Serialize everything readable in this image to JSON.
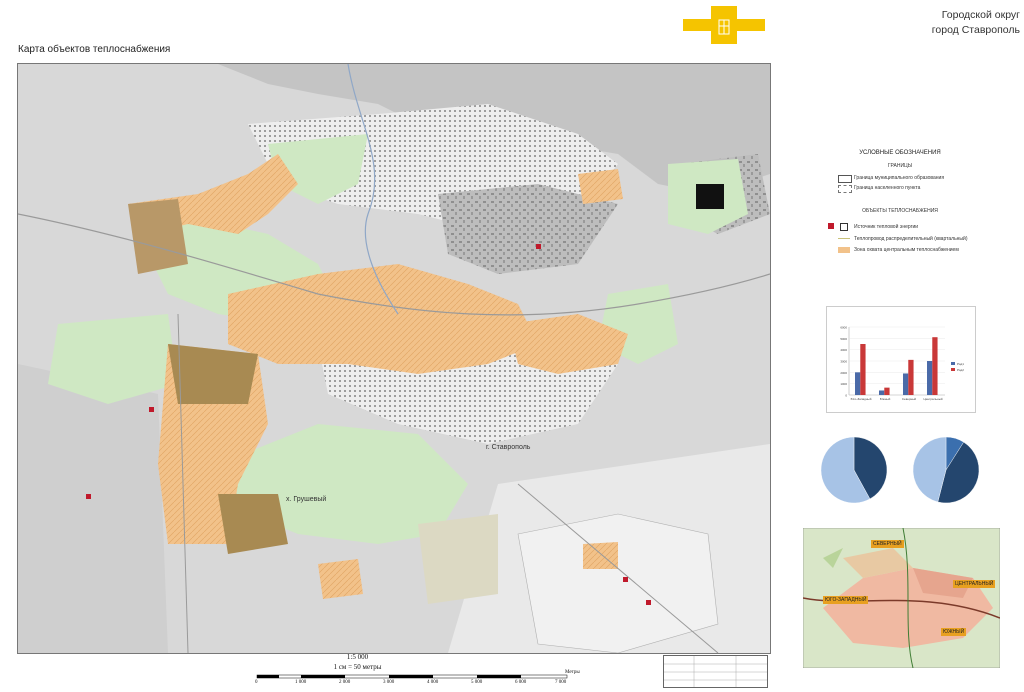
{
  "header": {
    "region_line1": "Городской округ",
    "region_line2": "город Ставрополь",
    "map_title": "Карта объектов теплоснабжения"
  },
  "map_labels": {
    "city": "г. Ставрополь",
    "khutor": "х. Грушевый"
  },
  "scale": {
    "ratio": "1:5 000",
    "per_cm": "1 см = 50 метры",
    "unit": "Метры",
    "ticks": [
      "0",
      "1 000",
      "2 000",
      "3 000",
      "4 000",
      "5 000",
      "6 000",
      "7 000"
    ]
  },
  "legend": {
    "title": "УСЛОВНЫЕ ОБОЗНАЧЕНИЯ",
    "group_borders": "ГРАНИЦЫ",
    "border_municipal": "Граница муниципального образования",
    "border_settlement": "Граница населенного пункта",
    "group_heat": "ОБЪЕКТЫ ТЕПЛОСНАБЖЕНИЯ",
    "heat_source": "Источник тепловой энергии",
    "pipeline": "Теплопровод распределительный (квартальный)",
    "central_zone": "Зона охвата центральным теплоснабжением"
  },
  "chart_data": [
    {
      "type": "bar",
      "categories": [
        "Юго-Западный",
        "Южный",
        "Северный",
        "Центральный"
      ],
      "series": [
        {
          "name": "Ряд1",
          "values": [
            2000,
            400,
            1900,
            3000
          ]
        },
        {
          "name": "Ряд2",
          "values": [
            4500,
            650,
            3100,
            5100
          ]
        }
      ],
      "ylim": [
        0,
        6000
      ],
      "yticks": [
        "0",
        "1000",
        "2000",
        "3000",
        "4000",
        "5000",
        "6000"
      ],
      "colors": [
        "#4a6aa8",
        "#c93838"
      ],
      "legend": "right"
    },
    {
      "type": "pie",
      "values": [
        42,
        58
      ],
      "colors": [
        "#24466e",
        "#a7c3e6"
      ]
    },
    {
      "type": "pie",
      "values": [
        9,
        45,
        46
      ],
      "colors": [
        "#3b6fae",
        "#24466e",
        "#a7c3e6"
      ]
    }
  ],
  "inset": {
    "districts": [
      "СЕВЕРНЫЙ",
      "ЦЕНТРАЛЬНЫЙ",
      "ЮГО-ЗАПАДНЫЙ",
      "ЮЖНЫЙ"
    ]
  },
  "colors": {
    "emblem": "#f5c400",
    "zone": "#f2c28a",
    "zone_dark": "#a88a52",
    "green": "#cfe8c3",
    "grey": "#c9c9c9",
    "district_label": "#e8a020"
  }
}
